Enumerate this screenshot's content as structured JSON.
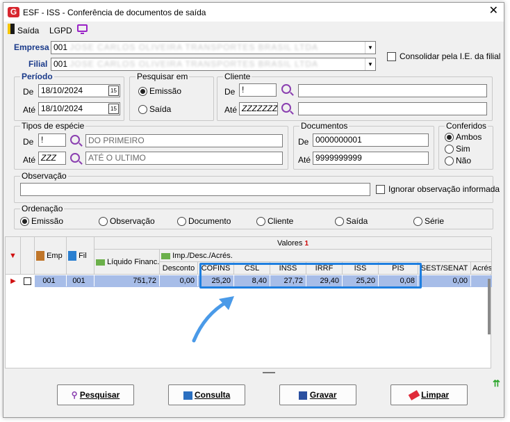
{
  "window": {
    "title": "ESF - ISS - Conferência de documentos de saída",
    "close": "✕"
  },
  "menu": {
    "exit": "Saída",
    "lgpd": "LGPD"
  },
  "empresa": {
    "label": "Empresa",
    "value": "001",
    "blurred": "JOSE CARLOS OLIVEIRA TRANSPORTES BRASIL LTDA"
  },
  "filial": {
    "label": "Filial",
    "value": "001",
    "blurred": "JOSE CARLOS OLIVEIRA TRANSPORTES BRASIL LTDA"
  },
  "consolidar": "Consolidar pela I.E. da filial",
  "periodo": {
    "title": "Período",
    "de_label": "De",
    "de": "18/10/2024",
    "ate_label": "Até",
    "ate": "18/10/2024",
    "cal": "15"
  },
  "pesquisar_em": {
    "title": "Pesquisar em",
    "opt1": "Emissão",
    "opt2": "Saída"
  },
  "cliente": {
    "title": "Cliente",
    "de_label": "De",
    "de": "!",
    "ate_label": "Até",
    "ate": "ZZZZZZZ"
  },
  "tipos_especie": {
    "title": "Tipos de espécie",
    "de_label": "De",
    "de": "!",
    "de_desc": "DO PRIMEIRO",
    "ate_label": "Até",
    "ate": "ZZZ",
    "ate_desc": "ATÉ O ULTIMO"
  },
  "documentos": {
    "title": "Documentos",
    "de_label": "De",
    "de": "0000000001",
    "ate_label": "Até",
    "ate": "9999999999"
  },
  "conferidos": {
    "title": "Conferidos",
    "opt1": "Ambos",
    "opt2": "Sim",
    "opt3": "Não"
  },
  "observacao": {
    "title": "Observação",
    "ignore": "Ignorar observação informada"
  },
  "ordenacao": {
    "title": "Ordenação",
    "opts": [
      "Emissão",
      "Observação",
      "Documento",
      "Cliente",
      "Saída",
      "Série"
    ]
  },
  "grid": {
    "valores": "Valores",
    "valores_badge": "1",
    "emp": "Emp",
    "fil": "Fil",
    "liquido": "Líquido Financ.",
    "imp": "Imp./Desc./Acrés.",
    "cols": [
      "Desconto",
      "COFINS",
      "CSL",
      "INSS",
      "IRRF",
      "ISS",
      "PIS",
      "SEST/SENAT",
      "Acrés"
    ],
    "row": {
      "emp": "001",
      "fil": "001",
      "liquido": "751,72",
      "vals": [
        "0,00",
        "25,20",
        "8,40",
        "27,72",
        "29,40",
        "25,20",
        "0,08",
        "0,00",
        ""
      ]
    }
  },
  "buttons": {
    "pesquisar": "Pesquisar",
    "consulta": "Consulta",
    "gravar": "Gravar",
    "limpar": "Limpar"
  }
}
